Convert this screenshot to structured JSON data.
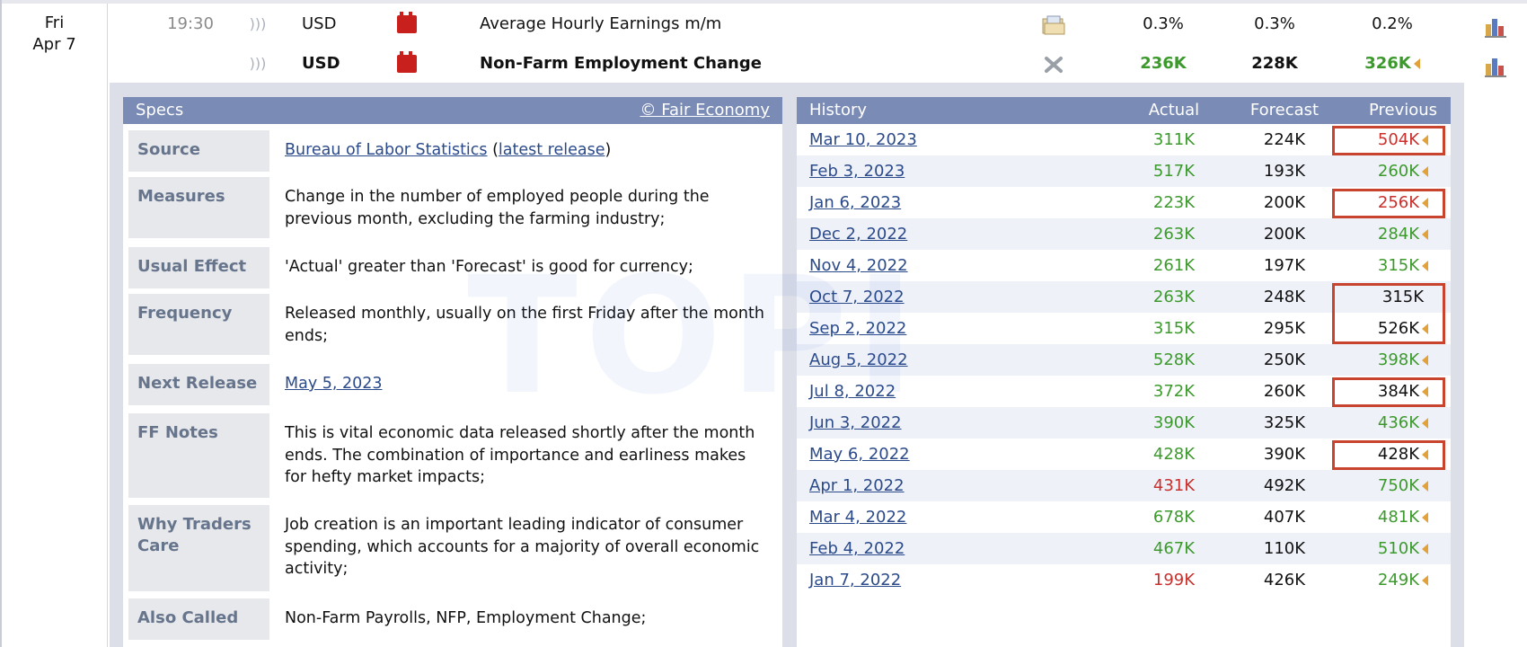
{
  "date": {
    "day": "Fri",
    "date": "Apr 7"
  },
  "events": [
    {
      "time": "19:30",
      "currency": "USD",
      "name": "Average Hourly Earnings m/m",
      "actual": "0.3%",
      "forecast": "0.3%",
      "previous": "0.2%",
      "detail_icon": "folder-icon",
      "bold": false
    },
    {
      "time": "",
      "currency": "USD",
      "name": "Non-Farm Employment Change",
      "actual": "236K",
      "forecast": "228K",
      "previous": "326K",
      "detail_icon": "close-icon",
      "bold": true
    }
  ],
  "specs": {
    "title": "Specs",
    "credit": "© Fair Economy",
    "rows": [
      {
        "label": "Source",
        "value_link": "Bureau of Labor Statistics",
        "value_mid": " (",
        "value_link2": "latest release",
        "value_end": ")"
      },
      {
        "label": "Measures",
        "value": "Change in the number of employed people during the previous month, excluding the farming industry;"
      },
      {
        "label": "Usual Effect",
        "value": "'Actual' greater than 'Forecast' is good for currency;"
      },
      {
        "label": "Frequency",
        "value": "Released monthly, usually on the first Friday after the month ends;"
      },
      {
        "label": "Next Release",
        "value_link": "May 5, 2023"
      },
      {
        "label": "FF Notes",
        "value": "This is vital economic data released shortly after the month ends. The combination of importance and earliness makes for hefty market impacts;"
      },
      {
        "label": "Why Traders Care",
        "value": "Job creation is an important leading indicator of consumer spending, which accounts for a majority of overall economic activity;"
      },
      {
        "label": "Also Called",
        "value": "Non-Farm Payrolls, NFP, Employment Change;"
      }
    ]
  },
  "history": {
    "headers": {
      "title": "History",
      "actual": "Actual",
      "forecast": "Forecast",
      "previous": "Previous"
    },
    "rows": [
      {
        "date": "Mar 10, 2023",
        "actual": "311K",
        "forecast": "224K",
        "previous": "504K",
        "actual_color": "green",
        "prev_color": "red",
        "revised": true
      },
      {
        "date": "Feb 3, 2023",
        "actual": "517K",
        "forecast": "193K",
        "previous": "260K",
        "actual_color": "green",
        "prev_color": "green",
        "revised": true
      },
      {
        "date": "Jan 6, 2023",
        "actual": "223K",
        "forecast": "200K",
        "previous": "256K",
        "actual_color": "green",
        "prev_color": "red",
        "revised": true
      },
      {
        "date": "Dec 2, 2022",
        "actual": "263K",
        "forecast": "200K",
        "previous": "284K",
        "actual_color": "green",
        "prev_color": "green",
        "revised": true
      },
      {
        "date": "Nov 4, 2022",
        "actual": "261K",
        "forecast": "197K",
        "previous": "315K",
        "actual_color": "green",
        "prev_color": "green",
        "revised": true
      },
      {
        "date": "Oct 7, 2022",
        "actual": "263K",
        "forecast": "248K",
        "previous": "315K",
        "actual_color": "green",
        "prev_color": "black",
        "revised": false
      },
      {
        "date": "Sep 2, 2022",
        "actual": "315K",
        "forecast": "295K",
        "previous": "526K",
        "actual_color": "green",
        "prev_color": "black",
        "revised": true
      },
      {
        "date": "Aug 5, 2022",
        "actual": "528K",
        "forecast": "250K",
        "previous": "398K",
        "actual_color": "green",
        "prev_color": "green",
        "revised": true
      },
      {
        "date": "Jul 8, 2022",
        "actual": "372K",
        "forecast": "260K",
        "previous": "384K",
        "actual_color": "green",
        "prev_color": "black",
        "revised": true
      },
      {
        "date": "Jun 3, 2022",
        "actual": "390K",
        "forecast": "325K",
        "previous": "436K",
        "actual_color": "green",
        "prev_color": "green",
        "revised": true
      },
      {
        "date": "May 6, 2022",
        "actual": "428K",
        "forecast": "390K",
        "previous": "428K",
        "actual_color": "green",
        "prev_color": "black",
        "revised": true
      },
      {
        "date": "Apr 1, 2022",
        "actual": "431K",
        "forecast": "492K",
        "previous": "750K",
        "actual_color": "red",
        "prev_color": "green",
        "revised": true
      },
      {
        "date": "Mar 4, 2022",
        "actual": "678K",
        "forecast": "407K",
        "previous": "481K",
        "actual_color": "green",
        "prev_color": "green",
        "revised": true
      },
      {
        "date": "Feb 4, 2022",
        "actual": "467K",
        "forecast": "110K",
        "previous": "510K",
        "actual_color": "green",
        "prev_color": "green",
        "revised": true
      },
      {
        "date": "Jan 7, 2022",
        "actual": "199K",
        "forecast": "426K",
        "previous": "249K",
        "actual_color": "red",
        "prev_color": "green",
        "revised": true
      }
    ],
    "highlighted_rows": [
      0,
      2,
      5,
      6,
      8,
      10
    ]
  },
  "colors": {
    "panel_header": "#7a8bb5",
    "green": "#3c9a2c",
    "red": "#c9302c",
    "highlight_box": "#c9442f",
    "link": "#2b4a8a"
  }
}
